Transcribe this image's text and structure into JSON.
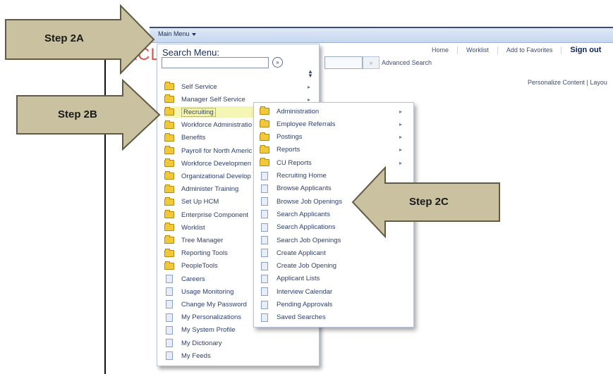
{
  "navbar": {
    "main_menu_label": "Main Menu"
  },
  "logo": {
    "text": "ORACLE"
  },
  "header_links": [
    "Home",
    "Worklist",
    "Add to Favorites",
    "Sign out"
  ],
  "search_bar": {
    "go_label": "»",
    "advanced_label": "Advanced Search"
  },
  "personalize": {
    "text": "Personalize Content | Layou"
  },
  "main_menu": {
    "title": "Search Menu:",
    "search_value": "",
    "items": [
      {
        "label": "Self Service",
        "type": "folder",
        "has_submenu": true
      },
      {
        "label": "Manager Self Service",
        "type": "folder",
        "has_submenu": true
      },
      {
        "label": "Recruiting",
        "type": "folder",
        "has_submenu": true,
        "selected": true
      },
      {
        "label": "Workforce Administratio",
        "type": "folder"
      },
      {
        "label": "Benefits",
        "type": "folder"
      },
      {
        "label": "Payroll for North Americ",
        "type": "folder"
      },
      {
        "label": "Workforce Developmen",
        "type": "folder"
      },
      {
        "label": "Organizational Develop",
        "type": "folder"
      },
      {
        "label": "Administer Training",
        "type": "folder"
      },
      {
        "label": "Set Up HCM",
        "type": "folder"
      },
      {
        "label": "Enterprise Component",
        "type": "folder"
      },
      {
        "label": "Worklist",
        "type": "folder"
      },
      {
        "label": "Tree Manager",
        "type": "folder"
      },
      {
        "label": "Reporting Tools",
        "type": "folder"
      },
      {
        "label": "PeopleTools",
        "type": "folder"
      },
      {
        "label": "Careers",
        "type": "doc"
      },
      {
        "label": "Usage Monitoring",
        "type": "doc"
      },
      {
        "label": "Change My Password",
        "type": "doc"
      },
      {
        "label": "My Personalizations",
        "type": "doc"
      },
      {
        "label": "My System Profile",
        "type": "doc"
      },
      {
        "label": "My Dictionary",
        "type": "doc"
      },
      {
        "label": "My Feeds",
        "type": "doc"
      }
    ]
  },
  "recruiting_menu": {
    "items": [
      {
        "label": "Administration",
        "type": "folder",
        "has_submenu": true
      },
      {
        "label": "Employee Referrals",
        "type": "folder",
        "has_submenu": true
      },
      {
        "label": "Postings",
        "type": "folder",
        "has_submenu": true
      },
      {
        "label": "Reports",
        "type": "folder",
        "has_submenu": true
      },
      {
        "label": "CU Reports",
        "type": "folder",
        "has_submenu": true
      },
      {
        "label": "Recruiting Home",
        "type": "doc"
      },
      {
        "label": "Browse Applicants",
        "type": "doc"
      },
      {
        "label": "Browse Job Openings",
        "type": "doc"
      },
      {
        "label": "Search Applicants",
        "type": "doc"
      },
      {
        "label": "Search Applications",
        "type": "doc"
      },
      {
        "label": "Search Job Openings",
        "type": "doc"
      },
      {
        "label": "Create Applicant",
        "type": "doc"
      },
      {
        "label": "Create Job Opening",
        "type": "doc"
      },
      {
        "label": "Applicant Lists",
        "type": "doc"
      },
      {
        "label": "Interview Calendar",
        "type": "doc"
      },
      {
        "label": "Pending Approvals",
        "type": "doc"
      },
      {
        "label": "Saved Searches",
        "type": "doc"
      }
    ]
  },
  "callouts": [
    {
      "label": "Step 2A"
    },
    {
      "label": "Step 2B"
    },
    {
      "label": "Step 2C"
    }
  ],
  "colors": {
    "callout_fill": "#c9c19f",
    "callout_stroke": "#615a44",
    "selected_row": "#f6f6b4",
    "logo": "#e8504a"
  }
}
